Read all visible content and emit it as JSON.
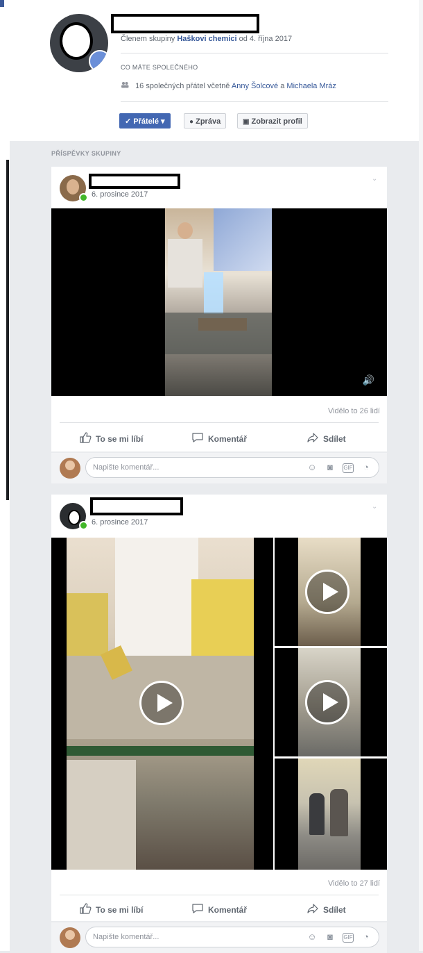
{
  "profile": {
    "member_prefix": "Členem skupiny",
    "group_name": "Haškovi chemici",
    "member_since": "od 4. října 2017",
    "common_heading": "CO MÁTE SPOLEČNÉHO",
    "mutual_prefix": "16 společných přátel včetně",
    "mutual_name1": "Anny Šolcové",
    "mutual_and": "a",
    "mutual_name2": "Michaela Mráz",
    "btn_friends": "✓ Přátelé ▾",
    "btn_message": "Zpráva",
    "btn_profile": "Zobrazit profil"
  },
  "section_label": "PŘÍSPĚVKY SKUPINY",
  "posts": [
    {
      "date": "6. prosince 2017",
      "views": "Vidělo to 26 lidí",
      "like": "To se mi líbí",
      "comment": "Komentář",
      "share": "Sdílet",
      "comment_placeholder": "Napište komentář..."
    },
    {
      "date": "6. prosince 2017",
      "views": "Vidělo to 27 lidí",
      "like": "To se mi líbí",
      "comment": "Komentář",
      "share": "Sdílet",
      "comment_placeholder": "Napište komentář..."
    }
  ],
  "icons": {
    "mutual": "people-icon",
    "message": "chat-bubble-icon",
    "profile": "id-card-icon",
    "volume": "speaker-icon",
    "like": "thumbs-up-icon",
    "comment": "speech-bubble-icon",
    "share": "share-arrow-icon",
    "emoji": "smiley-icon",
    "camera": "camera-icon",
    "gif": "gif-icon",
    "sticker": "sticker-icon"
  },
  "colors": {
    "accent": "#4267b2",
    "link": "#365899",
    "online": "#42b72a"
  }
}
